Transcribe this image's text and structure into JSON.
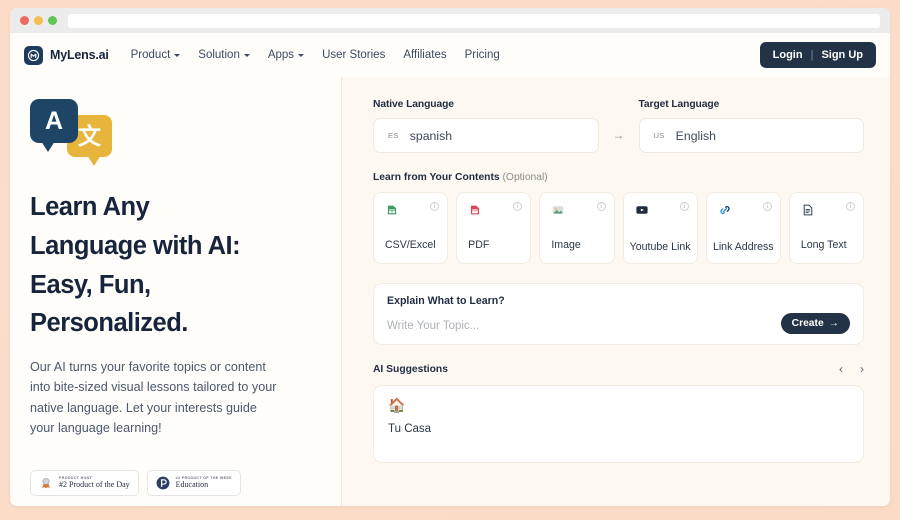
{
  "browser": {
    "traffic_lights": [
      "close-red",
      "minimize-yellow",
      "maximize-green"
    ],
    "url_value": ""
  },
  "header": {
    "brand_name": "MyLens.ai",
    "brand_icon": "lens-logo-icon",
    "nav": [
      {
        "label": "Product",
        "has_caret": true
      },
      {
        "label": "Solution",
        "has_caret": true
      },
      {
        "label": "Apps",
        "has_caret": true
      },
      {
        "label": "User Stories",
        "has_caret": false
      },
      {
        "label": "Affiliates",
        "has_caret": false
      },
      {
        "label": "Pricing",
        "has_caret": false
      }
    ],
    "login_label": "Login",
    "separator": "|",
    "signup_label": "Sign Up"
  },
  "hero": {
    "illustration": {
      "bubble_a_text": "A",
      "bubble_z_text": "文",
      "bubble_a_color": "#1e4466",
      "bubble_z_color": "#e8b53c"
    },
    "title_lines": [
      "Learn Any",
      "Language with AI:",
      "Easy, Fun,",
      "Personalized."
    ],
    "subtitle": "Our AI turns your favorite topics or content into bite-sized visual lessons tailored to your native language. Let your interests guide your language learning!",
    "badges": [
      {
        "icon": "product-hunt-medal-icon",
        "kicker": "PRODUCT HUNT",
        "label": "#2 Product of the Day"
      },
      {
        "icon": "product-hunt-p-icon",
        "kicker": "#2 PRODUCT OF THE WEEK",
        "label": "Education"
      }
    ]
  },
  "panel": {
    "native_language": {
      "label": "Native Language",
      "code": "ES",
      "value": "spanish"
    },
    "direction_arrow": "→",
    "target_language": {
      "label": "Target Language",
      "code": "US",
      "value": "English"
    },
    "contents_section": {
      "title": "Learn from Your Contents",
      "optional": "(Optional)",
      "info_glyph": "i",
      "cards": [
        {
          "label": "CSV/Excel",
          "icon": "csv-excel-icon",
          "icon_color": "#3e9a5c",
          "two_line": false
        },
        {
          "label": "PDF",
          "icon": "pdf-icon",
          "icon_color": "#d9475e",
          "two_line": false
        },
        {
          "label": "Image",
          "icon": "image-icon",
          "icon_color": "#4f9b6b",
          "two_line": false
        },
        {
          "label": "Youtube Link",
          "icon": "youtube-icon",
          "icon_color": "#1f2a3c",
          "two_line": true
        },
        {
          "label": "Link Address",
          "icon": "link-icon",
          "icon_color": "#2f8fd4",
          "two_line": true
        },
        {
          "label": "Long Text",
          "icon": "long-text-icon",
          "icon_color": "#32404f",
          "two_line": false
        }
      ]
    },
    "topic_box": {
      "title": "Explain What to Learn?",
      "input_value": "",
      "placeholder": "Write Your Topic...",
      "create_label": "Create",
      "create_arrow": "→"
    },
    "suggestions": {
      "title": "AI Suggestions",
      "prev_icon": "chevron-left-icon",
      "next_icon": "chevron-right-icon",
      "prev_glyph": "‹",
      "next_glyph": "›",
      "items": [
        {
          "emoji": "🏠",
          "label": "Tu Casa"
        }
      ]
    }
  },
  "colors": {
    "frame": "#fbdcc8",
    "panel_bg": "#fdf8f1",
    "hero_bg": "#fffdfa",
    "brand_navy": "#233347",
    "accent_gold": "#e8b53c"
  }
}
